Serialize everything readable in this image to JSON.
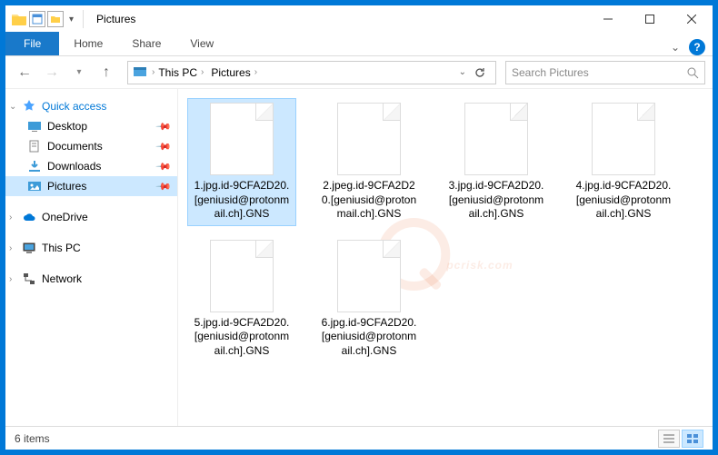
{
  "titlebar": {
    "title": "Pictures"
  },
  "ribbon": {
    "file": "File",
    "tabs": [
      "Home",
      "Share",
      "View"
    ]
  },
  "nav": {
    "breadcrumb": [
      "This PC",
      "Pictures"
    ],
    "search_placeholder": "Search Pictures"
  },
  "sidebar": {
    "quick_access": "Quick access",
    "items": [
      {
        "label": "Desktop",
        "icon": "desktop"
      },
      {
        "label": "Documents",
        "icon": "documents"
      },
      {
        "label": "Downloads",
        "icon": "downloads"
      },
      {
        "label": "Pictures",
        "icon": "pictures",
        "selected": true
      }
    ],
    "onedrive": "OneDrive",
    "thispc": "This PC",
    "network": "Network"
  },
  "files": [
    {
      "name": "1.jpg.id-9CFA2D20.[geniusid@protonmail.ch].GNS",
      "selected": true
    },
    {
      "name": "2.jpeg.id-9CFA2D20.[geniusid@protonmail.ch].GNS"
    },
    {
      "name": "3.jpg.id-9CFA2D20.[geniusid@protonmail.ch].GNS"
    },
    {
      "name": "4.jpg.id-9CFA2D20.[geniusid@protonmail.ch].GNS"
    },
    {
      "name": "5.jpg.id-9CFA2D20.[geniusid@protonmail.ch].GNS"
    },
    {
      "name": "6.jpg.id-9CFA2D20.[geniusid@protonmail.ch].GNS"
    }
  ],
  "statusbar": {
    "count": "6 items"
  },
  "watermark": "pcrisk.com"
}
